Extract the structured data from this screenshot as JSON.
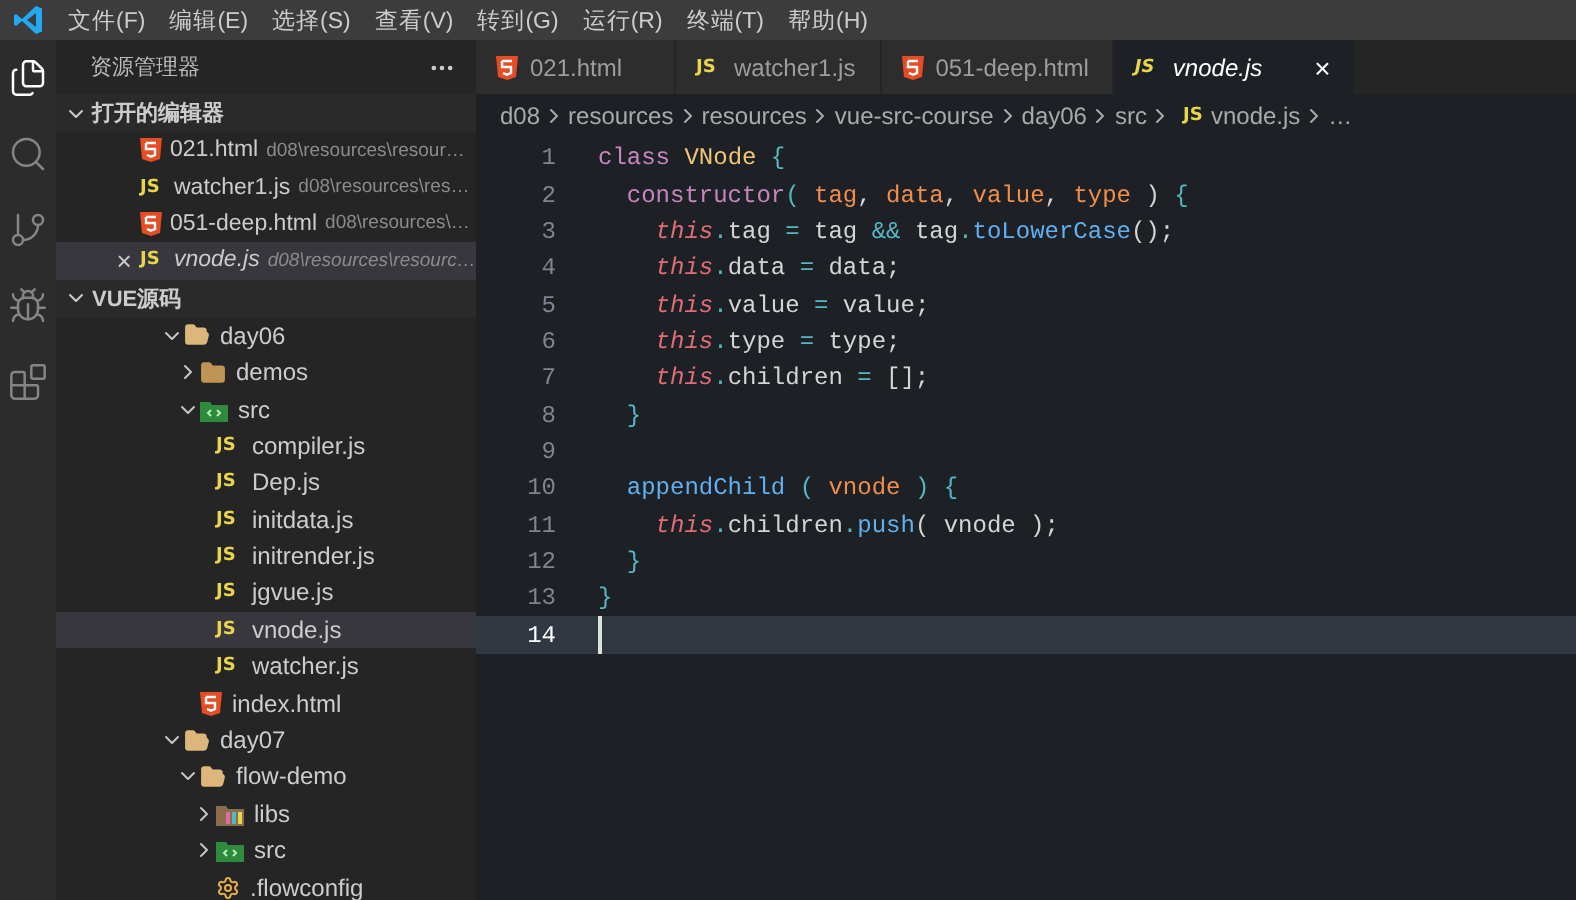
{
  "menu": [
    "文件(F)",
    "编辑(E)",
    "选择(S)",
    "查看(V)",
    "转到(G)",
    "运行(R)",
    "终端(T)",
    "帮助(H)"
  ],
  "activity_bar": [
    {
      "kind": "files",
      "selected": true
    },
    {
      "kind": "search",
      "selected": false
    },
    {
      "kind": "scm",
      "selected": false
    },
    {
      "kind": "debug",
      "selected": false
    },
    {
      "kind": "extensions",
      "selected": false
    }
  ],
  "sidebar": {
    "title": "资源管理器",
    "open_editors": {
      "title": "打开的编辑器",
      "expanded": true,
      "items": [
        {
          "name": "021.html",
          "path": "d08\\resources\\resour…",
          "kind": "html",
          "selected": false
        },
        {
          "name": "watcher1.js",
          "path": "d08\\resources\\res…",
          "kind": "js",
          "badge": "JS",
          "selected": false
        },
        {
          "name": "051-deep.html",
          "path": "d08\\resources\\…",
          "kind": "html",
          "selected": false
        },
        {
          "name": "vnode.js",
          "path": "d08\\resources\\resourc…",
          "kind": "js",
          "badge": "JS",
          "selected": true,
          "close": "×"
        }
      ]
    },
    "folder": {
      "title": "VUE源码",
      "expanded": true,
      "tree": [
        {
          "name": "day06",
          "kind": "folder",
          "expanded": true,
          "selected": false,
          "children": [
            {
              "name": "demos",
              "kind": "folder",
              "expanded": false,
              "selected": false
            },
            {
              "name": "src",
              "kind": "src-folder",
              "expanded": true,
              "selected": false,
              "children": [
                {
                  "name": "compiler.js",
                  "kind": "js",
                  "badge": "JS",
                  "selected": false
                },
                {
                  "name": "Dep.js",
                  "kind": "js",
                  "badge": "JS",
                  "selected": false
                },
                {
                  "name": "initdata.js",
                  "kind": "js",
                  "badge": "JS",
                  "selected": false
                },
                {
                  "name": "initrender.js",
                  "kind": "js",
                  "badge": "JS",
                  "selected": false
                },
                {
                  "name": "jgvue.js",
                  "kind": "js",
                  "badge": "JS",
                  "selected": false
                },
                {
                  "name": "vnode.js",
                  "kind": "js",
                  "badge": "JS",
                  "selected": true
                },
                {
                  "name": "watcher.js",
                  "kind": "js",
                  "badge": "JS",
                  "selected": false
                }
              ]
            },
            {
              "name": "index.html",
              "kind": "html",
              "selected": false
            }
          ]
        },
        {
          "name": "day07",
          "kind": "folder",
          "expanded": true,
          "selected": false,
          "children": [
            {
              "name": "flow-demo",
              "kind": "folder",
              "expanded": true,
              "selected": false,
              "children": [
                {
                  "name": "libs",
                  "kind": "lib-folder",
                  "expanded": false,
                  "selected": false
                },
                {
                  "name": "src",
                  "kind": "src-folder",
                  "expanded": false,
                  "selected": false
                },
                {
                  "name": ".flowconfig",
                  "kind": "config",
                  "selected": false
                }
              ]
            }
          ]
        }
      ]
    }
  },
  "tabs": [
    {
      "label": "021.html",
      "kind": "html",
      "selected": false
    },
    {
      "label": "watcher1.js",
      "kind": "js",
      "badge": "JS",
      "selected": false
    },
    {
      "label": "051-deep.html",
      "kind": "html",
      "selected": false
    },
    {
      "label": "vnode.js",
      "kind": "js",
      "badge": "JS",
      "selected": true,
      "close": "×"
    }
  ],
  "breadcrumb": [
    {
      "label": "d08"
    },
    {
      "label": "resources"
    },
    {
      "label": "resources"
    },
    {
      "label": "vue-src-course"
    },
    {
      "label": "day06"
    },
    {
      "label": "src"
    },
    {
      "label": "vnode.js",
      "kind": "js",
      "badge": "JS"
    },
    {
      "label": "…"
    }
  ],
  "code": [
    {
      "number": "1",
      "current": false,
      "tokens": [
        {
          "text": "class",
          "kind": "keyword"
        },
        {
          "text": " VNode",
          "kind": "class"
        },
        {
          "text": " {",
          "kind": "brace"
        }
      ]
    },
    {
      "number": "2",
      "current": false,
      "tokens": [
        {
          "text": "  constructor",
          "kind": "keyword"
        },
        {
          "text": "( ",
          "kind": "brace"
        },
        {
          "text": "tag",
          "kind": "param"
        },
        {
          "text": ", ",
          "kind": "plain"
        },
        {
          "text": "data",
          "kind": "param"
        },
        {
          "text": ", ",
          "kind": "plain"
        },
        {
          "text": "value",
          "kind": "param"
        },
        {
          "text": ", ",
          "kind": "plain"
        },
        {
          "text": "type",
          "kind": "param"
        },
        {
          "text": " ) ",
          "kind": "plain"
        },
        {
          "text": "{",
          "kind": "brace"
        }
      ]
    },
    {
      "number": "3",
      "current": false,
      "tokens": [
        {
          "text": "    this",
          "kind": "this"
        },
        {
          "text": ".",
          "kind": "op"
        },
        {
          "text": "tag ",
          "kind": "plain"
        },
        {
          "text": "=",
          "kind": "op"
        },
        {
          "text": " tag ",
          "kind": "plain"
        },
        {
          "text": "&&",
          "kind": "op"
        },
        {
          "text": " tag",
          "kind": "plain"
        },
        {
          "text": ".",
          "kind": "op"
        },
        {
          "text": "toLowerCase",
          "kind": "func"
        },
        {
          "text": "();",
          "kind": "plain"
        }
      ]
    },
    {
      "number": "4",
      "current": false,
      "tokens": [
        {
          "text": "    this",
          "kind": "this"
        },
        {
          "text": ".",
          "kind": "op"
        },
        {
          "text": "data ",
          "kind": "plain"
        },
        {
          "text": "=",
          "kind": "op"
        },
        {
          "text": " data;",
          "kind": "plain"
        }
      ]
    },
    {
      "number": "5",
      "current": false,
      "tokens": [
        {
          "text": "    this",
          "kind": "this"
        },
        {
          "text": ".",
          "kind": "op"
        },
        {
          "text": "value ",
          "kind": "plain"
        },
        {
          "text": "=",
          "kind": "op"
        },
        {
          "text": " value;",
          "kind": "plain"
        }
      ]
    },
    {
      "number": "6",
      "current": false,
      "tokens": [
        {
          "text": "    this",
          "kind": "this"
        },
        {
          "text": ".",
          "kind": "op"
        },
        {
          "text": "type ",
          "kind": "plain"
        },
        {
          "text": "=",
          "kind": "op"
        },
        {
          "text": " type;",
          "kind": "plain"
        }
      ]
    },
    {
      "number": "7",
      "current": false,
      "tokens": [
        {
          "text": "    this",
          "kind": "this"
        },
        {
          "text": ".",
          "kind": "op"
        },
        {
          "text": "children ",
          "kind": "plain"
        },
        {
          "text": "=",
          "kind": "op"
        },
        {
          "text": " [];",
          "kind": "plain"
        }
      ]
    },
    {
      "number": "8",
      "current": false,
      "tokens": [
        {
          "text": "  }",
          "kind": "brace"
        }
      ]
    },
    {
      "number": "9",
      "current": false
    },
    {
      "number": "10",
      "current": false,
      "tokens": [
        {
          "text": "  appendChild",
          "kind": "func"
        },
        {
          "text": " ( ",
          "kind": "brace"
        },
        {
          "text": "vnode",
          "kind": "param"
        },
        {
          "text": " ) ",
          "kind": "brace"
        },
        {
          "text": "{",
          "kind": "brace"
        }
      ]
    },
    {
      "number": "11",
      "current": false,
      "tokens": [
        {
          "text": "    this",
          "kind": "this"
        },
        {
          "text": ".",
          "kind": "op"
        },
        {
          "text": "children",
          "kind": "plain"
        },
        {
          "text": ".",
          "kind": "op"
        },
        {
          "text": "push",
          "kind": "func"
        },
        {
          "text": "( vnode );",
          "kind": "plain"
        }
      ]
    },
    {
      "number": "12",
      "current": false,
      "tokens": [
        {
          "text": "  }",
          "kind": "brace"
        }
      ]
    },
    {
      "number": "13",
      "current": false,
      "tokens": [
        {
          "text": "}",
          "kind": "brace"
        }
      ]
    },
    {
      "number": "14",
      "current": true
    }
  ]
}
